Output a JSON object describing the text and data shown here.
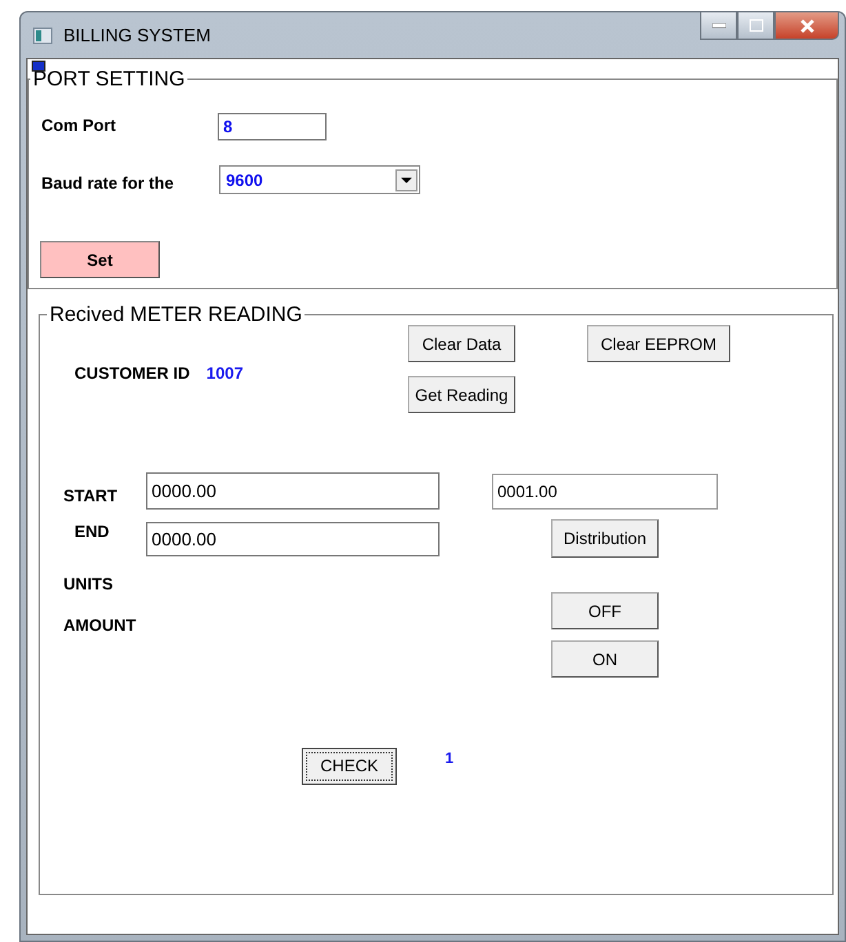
{
  "window": {
    "title": "BILLING SYSTEM"
  },
  "port_setting": {
    "title": "PORT SETTING",
    "com_port_label": "Com Port",
    "com_port_value": "8",
    "baud_label": "Baud rate for the",
    "baud_value": "9600",
    "set_button": "Set"
  },
  "meter_reading": {
    "title": "Recived METER READING",
    "clear_data_button": "Clear Data",
    "clear_eeprom_button": "Clear EEPROM",
    "get_reading_button": "Get Reading",
    "customer_id_label": "CUSTOMER ID",
    "customer_id": "1007",
    "start_label": "START",
    "start_value": "0000.00",
    "end_label": "END",
    "end_value": "0000.00",
    "field_3_value": "0001.00",
    "distribution_button": "Distribution",
    "units_label": "UNITS",
    "amount_label": "AMOUNT",
    "off_button": "OFF",
    "on_button": "ON",
    "check_button": "CHECK",
    "check_result": "1"
  }
}
